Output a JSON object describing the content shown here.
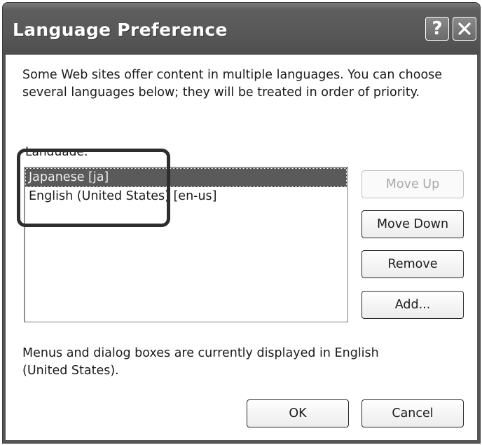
{
  "window": {
    "title": "Language Preference",
    "help_glyph": "?",
    "close_icon": "close-icon"
  },
  "intro": "Some Web sites offer content in multiple languages. You can choose several languages below; they will be treated in order of priority.",
  "language_label": "Language:",
  "languages": [
    {
      "label": "Japanese [ja]",
      "selected": true
    },
    {
      "label": "English (United States) [en-us]",
      "selected": false
    }
  ],
  "buttons": {
    "move_up": "Move Up",
    "move_down": "Move Down",
    "remove": "Remove",
    "add": "Add...",
    "ok": "OK",
    "cancel": "Cancel"
  },
  "footer": "Menus and dialog boxes are currently displayed in English (United States).",
  "colors": {
    "titlebar": "#585858",
    "selection": "#5a5a5a",
    "highlight_ring": "#2e2e2e"
  }
}
